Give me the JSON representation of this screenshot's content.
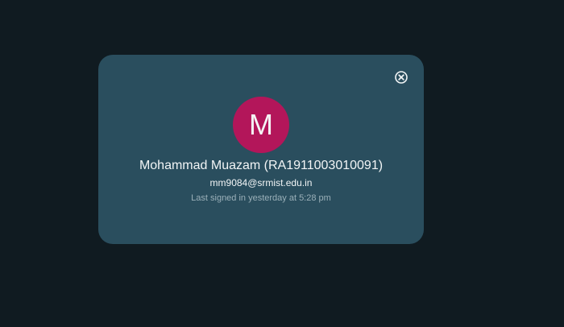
{
  "account_card": {
    "avatar_letter": "M",
    "name": "Mohammad Muazam (RA1911003010091)",
    "email": "mm9084@srmist.edu.in",
    "last_signed_in": "Last signed in yesterday at 5:28 pm",
    "close_icon": "close-circle-icon"
  },
  "colors": {
    "background": "#101b21",
    "card": "#2a4e5e",
    "avatar": "#b3165a"
  }
}
